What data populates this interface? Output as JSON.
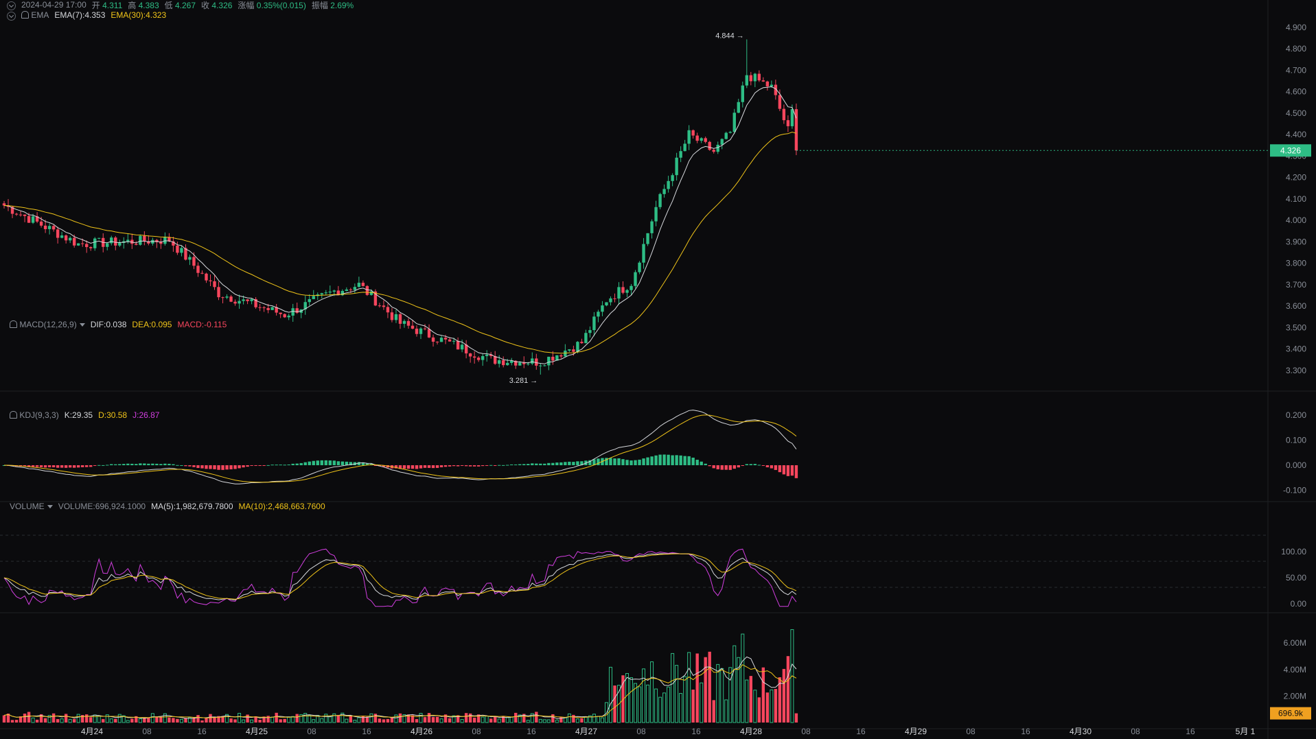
{
  "ohlc_bar": {
    "time": "2024-04-29 17:00",
    "open_label": "开",
    "open": "4.311",
    "high_label": "高",
    "high": "4.383",
    "low_label": "低",
    "low": "4.267",
    "close_label": "收",
    "close": "4.326",
    "change_label": "涨幅",
    "change": "0.35%(0.015)",
    "amplitude_label": "振幅",
    "amplitude": "2.69%"
  },
  "ema_legend": {
    "name": "EMA",
    "ema7": "EMA(7):4.353",
    "ema30": "EMA(30):4.323"
  },
  "macd_legend": {
    "name": "MACD(12,26,9)",
    "dif": "DIF:0.038",
    "dea": "DEA:0.095",
    "macd": "MACD:-0.115"
  },
  "kdj_legend": {
    "name": "KDJ(9,3,3)",
    "k": "K:29.35",
    "d": "D:30.58",
    "j": "J:26.87"
  },
  "volume_legend": {
    "name": "VOLUME",
    "vol": "VOLUME:696,924.1000",
    "ma5": "MA(5):1,982,679.7800",
    "ma10": "MA(10):2,468,663.7600"
  },
  "price_axis": [
    "4.900",
    "4.800",
    "4.700",
    "4.600",
    "4.500",
    "4.400",
    "4.300",
    "4.200",
    "4.100",
    "4.000",
    "3.900",
    "3.800",
    "3.700",
    "3.600",
    "3.500",
    "3.400",
    "3.300"
  ],
  "macd_axis": [
    "0.200",
    "0.100",
    "0.000",
    "-0.100"
  ],
  "kdj_axis": [
    "100.00",
    "50.00",
    "0.00"
  ],
  "volume_axis": [
    "6.00M",
    "4.00M",
    "2.00M"
  ],
  "current_price": "4.326",
  "current_volume": "696.9k",
  "high_marker": "4.844 →",
  "low_marker": "3.281 →",
  "time_axis": [
    {
      "label": "4月24",
      "bold": true
    },
    {
      "label": "08",
      "bold": false
    },
    {
      "label": "16",
      "bold": false
    },
    {
      "label": "4月25",
      "bold": true
    },
    {
      "label": "08",
      "bold": false
    },
    {
      "label": "16",
      "bold": false
    },
    {
      "label": "4月26",
      "bold": true
    },
    {
      "label": "08",
      "bold": false
    },
    {
      "label": "16",
      "bold": false
    },
    {
      "label": "4月27",
      "bold": true
    },
    {
      "label": "08",
      "bold": false
    },
    {
      "label": "16",
      "bold": false
    },
    {
      "label": "4月28",
      "bold": true
    },
    {
      "label": "08",
      "bold": false
    },
    {
      "label": "16",
      "bold": false
    },
    {
      "label": "4月29",
      "bold": true
    },
    {
      "label": "08",
      "bold": false
    },
    {
      "label": "16",
      "bold": false
    },
    {
      "label": "4月30",
      "bold": true
    },
    {
      "label": "08",
      "bold": false
    },
    {
      "label": "16",
      "bold": false
    },
    {
      "label": "5月 1",
      "bold": true
    }
  ],
  "colors": {
    "up": "#2ebd85",
    "down": "#f6465d",
    "ema7": "#d6d8dc",
    "ema30": "#f0c419",
    "j": "#d23ee0",
    "bg": "#0b0b0d",
    "grid": "#1c1d21",
    "accent": "#f0a020"
  },
  "chart_data": {
    "type": "candlestick",
    "x_start": "2024-04-23 17:00",
    "interval": "1h",
    "bars": 193,
    "price_ylim": [
      3.22,
      4.97
    ],
    "price_key_points": [
      [
        0,
        4.07
      ],
      [
        18,
        3.89
      ],
      [
        40,
        3.91
      ],
      [
        46,
        3.79
      ],
      [
        52,
        3.66
      ],
      [
        68,
        3.56
      ],
      [
        80,
        3.67
      ],
      [
        86,
        3.7
      ],
      [
        96,
        3.52
      ],
      [
        118,
        3.35
      ],
      [
        130,
        3.34
      ],
      [
        140,
        3.43
      ],
      [
        146,
        3.63
      ],
      [
        152,
        3.71
      ],
      [
        158,
        4.06
      ],
      [
        166,
        4.4
      ],
      [
        172,
        4.32
      ],
      [
        176,
        4.41
      ],
      [
        180,
        4.68
      ],
      [
        186,
        4.62
      ],
      [
        190,
        4.42
      ],
      [
        194,
        4.77
      ],
      [
        198,
        4.48
      ],
      [
        203,
        4.28
      ],
      [
        205,
        4.14
      ],
      [
        210,
        4.32
      ]
    ],
    "high": 4.844,
    "low": 3.281,
    "ema7_last": 4.353,
    "ema30_last": 4.323,
    "macd_last": {
      "dif": 0.038,
      "dea": 0.095,
      "macd": -0.115
    },
    "kdj_last": {
      "k": 29.35,
      "d": 30.58,
      "j": 26.87
    },
    "volume_last": 696924.1,
    "volume_ma5_last": 1982679.78,
    "volume_ma10_last": 2468663.76
  }
}
